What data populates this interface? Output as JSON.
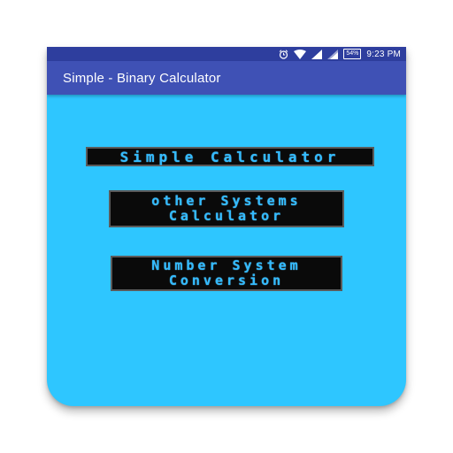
{
  "status_bar": {
    "battery_percent": "54%",
    "time": "9:23 PM",
    "icons": [
      "alarm-icon",
      "wifi-icon",
      "signal-icon",
      "signal-icon",
      "battery-icon"
    ]
  },
  "app_bar": {
    "title": "Simple - Binary Calculator"
  },
  "main": {
    "buttons": [
      {
        "label": "Simple Calculator"
      },
      {
        "label": "other Systems\nCalculator"
      },
      {
        "label": "Number System\nConversion"
      }
    ]
  },
  "colors": {
    "status_bar": "#2e3e9e",
    "app_bar": "#3f51b5",
    "background": "#2ec6ff",
    "button_bg": "#0a0a0a",
    "button_text": "#33bbff"
  }
}
